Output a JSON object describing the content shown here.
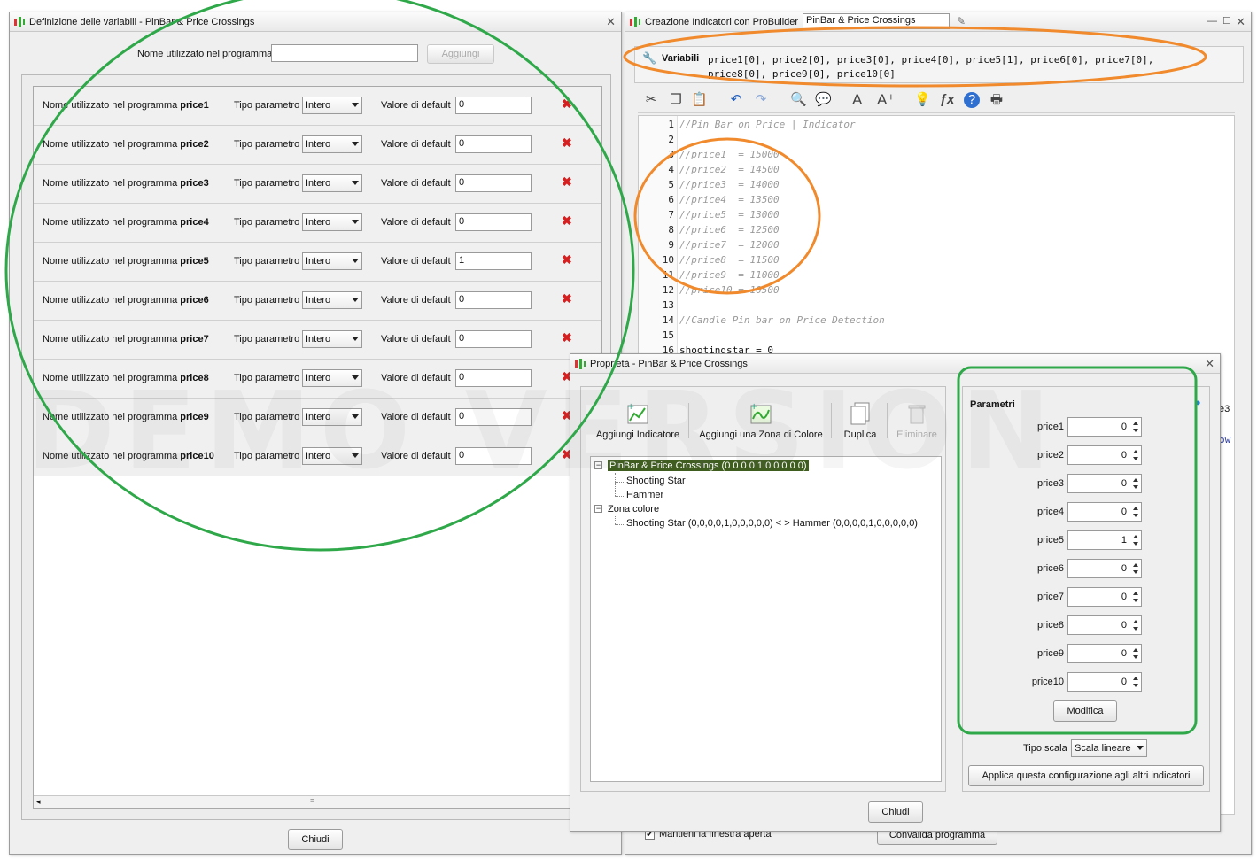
{
  "left_window": {
    "title": "Definizione delle variabili - PinBar & Price Crossings",
    "name_label": "Nome utilizzato nel programma",
    "name_value": "",
    "add_button": "Aggiungi",
    "rows": [
      {
        "name_label": "Nome utilizzato nel programma",
        "name": "price1",
        "type_label": "Tipo parametro",
        "type": "Intero",
        "default_label": "Valore di default",
        "default": "0"
      },
      {
        "name_label": "Nome utilizzato nel programma",
        "name": "price2",
        "type_label": "Tipo parametro",
        "type": "Intero",
        "default_label": "Valore di default",
        "default": "0"
      },
      {
        "name_label": "Nome utilizzato nel programma",
        "name": "price3",
        "type_label": "Tipo parametro",
        "type": "Intero",
        "default_label": "Valore di default",
        "default": "0"
      },
      {
        "name_label": "Nome utilizzato nel programma",
        "name": "price4",
        "type_label": "Tipo parametro",
        "type": "Intero",
        "default_label": "Valore di default",
        "default": "0"
      },
      {
        "name_label": "Nome utilizzato nel programma",
        "name": "price5",
        "type_label": "Tipo parametro",
        "type": "Intero",
        "default_label": "Valore di default",
        "default": "1"
      },
      {
        "name_label": "Nome utilizzato nel programma",
        "name": "price6",
        "type_label": "Tipo parametro",
        "type": "Intero",
        "default_label": "Valore di default",
        "default": "0"
      },
      {
        "name_label": "Nome utilizzato nel programma",
        "name": "price7",
        "type_label": "Tipo parametro",
        "type": "Intero",
        "default_label": "Valore di default",
        "default": "0"
      },
      {
        "name_label": "Nome utilizzato nel programma",
        "name": "price8",
        "type_label": "Tipo parametro",
        "type": "Intero",
        "default_label": "Valore di default",
        "default": "0"
      },
      {
        "name_label": "Nome utilizzato nel programma",
        "name": "price9",
        "type_label": "Tipo parametro",
        "type": "Intero",
        "default_label": "Valore di default",
        "default": "0"
      },
      {
        "name_label": "Nome utilizzato nel programma",
        "name": "price10",
        "type_label": "Tipo parametro",
        "type": "Intero",
        "default_label": "Valore di default",
        "default": "0"
      }
    ],
    "close_button": "Chiudi",
    "watermark": "DEMO VERSION"
  },
  "right_window": {
    "title": "Creazione Indicatori con ProBuilder",
    "title_field": "PinBar & Price Crossings",
    "variables_label": "Variabili",
    "variables_line1": "price1[0], price2[0], price3[0], price4[0], price5[1], price6[0], price7[0],",
    "variables_line2": "price8[0], price9[0], price10[0]",
    "code_lines": [
      {
        "n": "1",
        "text": "//Pin Bar on Price | Indicator",
        "kind": "comment"
      },
      {
        "n": "2",
        "text": "",
        "kind": "plain"
      },
      {
        "n": "3",
        "text": "//price1  = 15000",
        "kind": "comment"
      },
      {
        "n": "4",
        "text": "//price2  = 14500",
        "kind": "comment"
      },
      {
        "n": "5",
        "text": "//price3  = 14000",
        "kind": "comment"
      },
      {
        "n": "6",
        "text": "//price4  = 13500",
        "kind": "comment"
      },
      {
        "n": "7",
        "text": "//price5  = 13000",
        "kind": "comment"
      },
      {
        "n": "8",
        "text": "//price6  = 12500",
        "kind": "comment"
      },
      {
        "n": "9",
        "text": "//price7  = 12000",
        "kind": "comment"
      },
      {
        "n": "10",
        "text": "//price8  = 11500",
        "kind": "comment"
      },
      {
        "n": "11",
        "text": "//price9  = 11000",
        "kind": "comment"
      },
      {
        "n": "12",
        "text": "//price10 = 10500",
        "kind": "comment"
      },
      {
        "n": "13",
        "text": "",
        "kind": "plain"
      },
      {
        "n": "14",
        "text": "//Candle Pin bar on Price Detection",
        "kind": "comment"
      },
      {
        "n": "15",
        "text": "",
        "kind": "plain"
      },
      {
        "n": "16",
        "text": "shootingstar = 0",
        "kind": "plain"
      }
    ],
    "keep_open_label": "Mantieni la finestra aperta",
    "validate_button": "Convalida programma",
    "partial_right_text_1": "e3",
    "partial_right_text_2": "ow"
  },
  "props_window": {
    "title": "Proprietà - PinBar & Price Crossings",
    "toolbar": {
      "add_indicator": "Aggiungi Indicatore",
      "add_color_zone": "Aggiungi una Zona di Colore",
      "duplicate": "Duplica",
      "delete": "Eliminare"
    },
    "tree": {
      "root": "PinBar & Price Crossings (0 0 0 0 1 0 0 0 0 0)",
      "children": [
        "Shooting Star",
        "Hammer"
      ],
      "zone_root": "Zona colore",
      "zone_children": [
        "Shooting Star (0,0,0,0,1,0,0,0,0,0) < > Hammer (0,0,0,0,1,0,0,0,0,0)"
      ]
    },
    "params_title": "Parametri",
    "params": [
      {
        "label": "price1",
        "value": "0"
      },
      {
        "label": "price2",
        "value": "0"
      },
      {
        "label": "price3",
        "value": "0"
      },
      {
        "label": "price4",
        "value": "0"
      },
      {
        "label": "price5",
        "value": "1"
      },
      {
        "label": "price6",
        "value": "0"
      },
      {
        "label": "price7",
        "value": "0"
      },
      {
        "label": "price8",
        "value": "0"
      },
      {
        "label": "price9",
        "value": "0"
      },
      {
        "label": "price10",
        "value": "0"
      }
    ],
    "modify_button": "Modifica",
    "scale_label": "Tipo scala",
    "scale_value": "Scala lineare",
    "apply_button": "Applica questa configurazione agli altri indicatori",
    "close_button": "Chiudi"
  },
  "colors": {
    "highlight_orange": "#f08a2c",
    "highlight_green": "#2fa84a",
    "tree_selected_bg": "#3f5d1f",
    "delete_red": "#d42020"
  }
}
